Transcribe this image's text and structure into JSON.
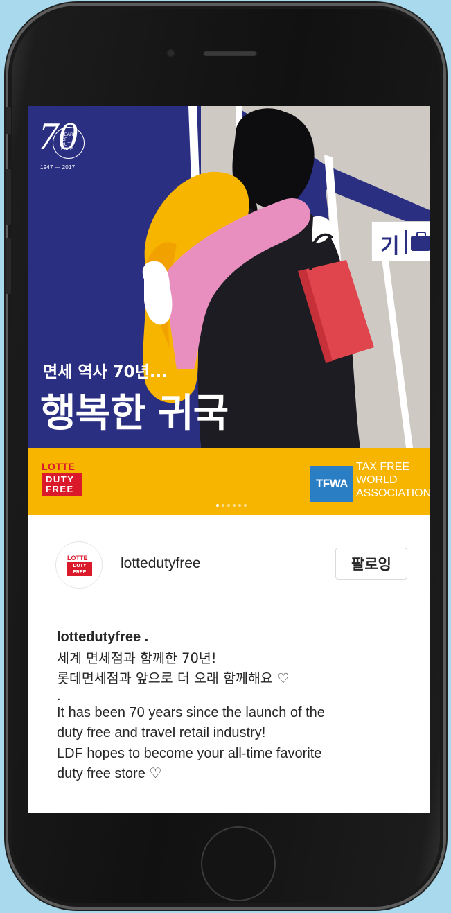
{
  "post": {
    "image": {
      "anniversary_logo": {
        "number": "70",
        "text_lines": [
          "YEARS",
          "OF",
          "DUTY",
          "FREE"
        ],
        "span": "1947 — 2017"
      },
      "headline_sub": "면세 역사 70년...",
      "headline_main": "행복한 귀국",
      "gate_sign_text": "기",
      "brand_logo": {
        "top": "LOTTE",
        "box_line1": "DUTY",
        "box_line2": "FREE"
      },
      "tfwa_logo": {
        "badge": "TFWA",
        "line1": "TAX FREE",
        "line2": "WORLD",
        "line3": "ASSOCIATION"
      },
      "carousel": {
        "count": 6,
        "active_index": 0
      },
      "colors": {
        "background": "#2b2f82",
        "brand_strip": "#f7b500",
        "lotte_red": "#da1a2a",
        "tfwa_blue": "#2a7ec4",
        "shopping_bag": "#e0454e",
        "scarf_pink": "#e88fbf",
        "hair_yellow": "#f7b500"
      }
    },
    "header": {
      "avatar": {
        "top": "LOTTE",
        "line1": "DUTY",
        "line2": "FREE"
      },
      "username": "lottedutyfree",
      "follow_label": "팔로잉"
    },
    "caption": {
      "username": "lottedutyfree .",
      "line1": "세계 면세점과 함께한 70년!",
      "line2": "롯데면세점과 앞으로 더 오래 함께해요 ♡",
      "separator": ".",
      "en_line1": "It has been 70 years since the launch of the",
      "en_line2": "duty free and travel retail industry!",
      "en_line3": "LDF hopes to become your all-time favorite",
      "en_line4": "duty free store ♡"
    }
  }
}
